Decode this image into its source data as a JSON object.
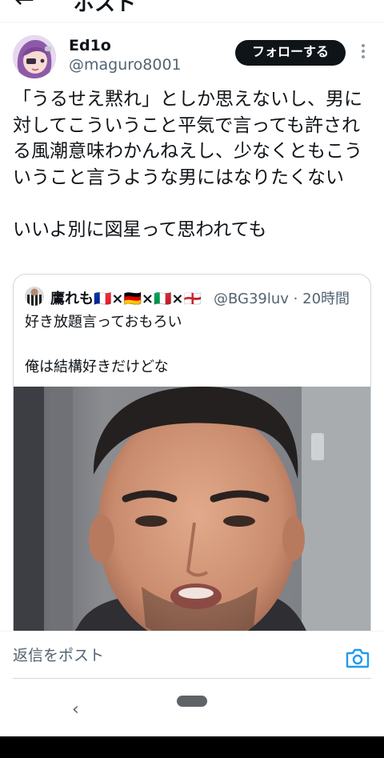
{
  "header": {
    "back_icon": "back-arrow-icon",
    "back_glyph": "←",
    "title": "ポスト"
  },
  "author": {
    "name": "Ed1o",
    "handle": "@maguro8001",
    "follow_label": "フォローする"
  },
  "tweet": {
    "text": "「うるせえ黙れ」としか思えないし、男に対してこういうこと平気で言っても許される風潮意味わかんねえし、少なくともこういうこと言うような男にはなりたくない\n\nいいよ別に図星って思われても"
  },
  "quote": {
    "name": "鷹れも🇫🇷×🇩🇪×🇮🇹×🏴󠁧󠁢󠁥󠁮󠁧󠁿",
    "handle": "@BG39luv · 20時間",
    "text": "好き放題言っておもろい\n\n俺は結構好きだけどな"
  },
  "reply": {
    "placeholder": "返信をポスト"
  },
  "nav": {
    "back_glyph": "‹"
  },
  "colors": {
    "primary_text": "#0f1419",
    "secondary_text": "#536471",
    "accent": "#1d9bf0",
    "follow_bg": "#0f1419"
  }
}
